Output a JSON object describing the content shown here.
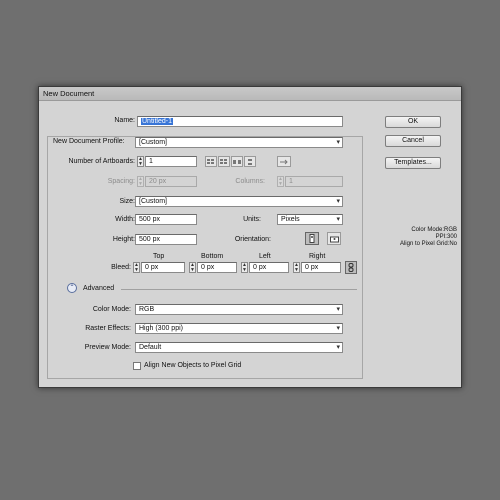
{
  "dialog": {
    "title": "New Document",
    "name_label": "Name:",
    "name_value": "Untitled-1",
    "profile_label": "New Document Profile:",
    "profile_value": "[Custom]",
    "artboards_label": "Number of Artboards:",
    "artboards_value": "1",
    "spacing_label": "Spacing:",
    "spacing_value": "20 px",
    "columns_label": "Columns:",
    "columns_value": "1",
    "size_label": "Size:",
    "size_value": "[Custom]",
    "width_label": "Width:",
    "width_value": "500 px",
    "units_label": "Units:",
    "units_value": "Pixels",
    "height_label": "Height:",
    "height_value": "500 px",
    "orientation_label": "Orientation:",
    "bleed_label": "Bleed:",
    "bleed": {
      "top_label": "Top",
      "top_value": "0 px",
      "bottom_label": "Bottom",
      "bottom_value": "0 px",
      "left_label": "Left",
      "left_value": "0 px",
      "right_label": "Right",
      "right_value": "0 px"
    },
    "advanced_label": "Advanced",
    "color_mode_label": "Color Mode:",
    "color_mode_value": "RGB",
    "raster_label": "Raster Effects:",
    "raster_value": "High (300 ppi)",
    "preview_label": "Preview Mode:",
    "preview_value": "Default",
    "align_checkbox_label": "Align New Objects to Pixel Grid",
    "align_checked": false,
    "ok_label": "OK",
    "cancel_label": "Cancel",
    "templates_label": "Templates...",
    "info": {
      "color_mode": "Color Mode:RGB",
      "ppi": "PPI:300",
      "align": "Align to Pixel Grid:No"
    }
  },
  "colors": {
    "background": "#6f6f6f",
    "dialog": "#d4d4d4",
    "selection": "#3875d7"
  }
}
